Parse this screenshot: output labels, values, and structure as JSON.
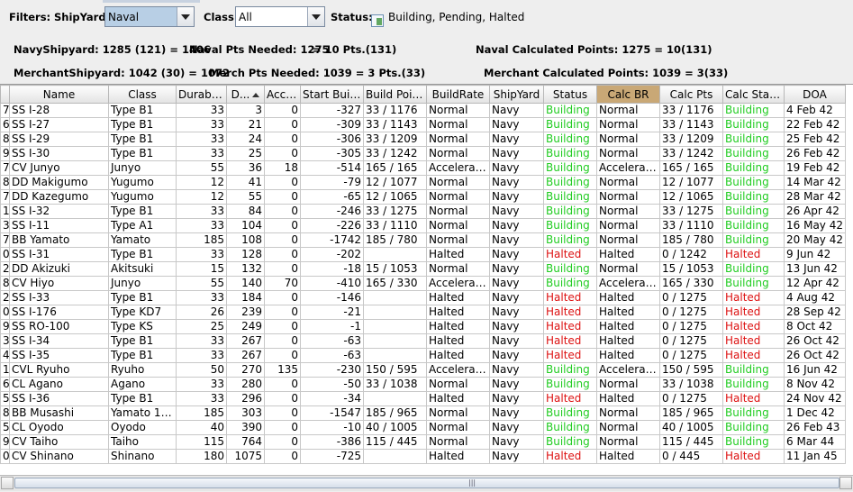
{
  "filters": {
    "label": "Filters:",
    "shipyard_label": "ShipYard:",
    "shipyard_value": "Naval",
    "class_label": "Class:",
    "class_value": "All",
    "status_label": "Status:",
    "status_value": "Building, Pending, Halted"
  },
  "summary": {
    "navy_shipyard": "NavyShipyard: 1285 (121) = 1406",
    "naval_pts_needed": "Naval Pts Needed: 1275",
    "naval_pts_result": "= 10 Pts.(131)",
    "naval_calc": "Naval Calculated Points:   1275 = 10(131)",
    "merchant_shipyard": "MerchantShipyard:  1042 (30) = 1072",
    "merch_pts_needed": "Merch Pts Needed: 1039 = 3 Pts.(33)",
    "merchant_calc": "Merchant Calculated Points:   1039 = 3(33)"
  },
  "table": {
    "columns": [
      "",
      "Name",
      "Class",
      "Durability",
      "D...",
      "Accel...",
      "Start Buildi...",
      "Build Point...",
      "BuildRate",
      "ShipYard",
      "Status",
      "Calc BR",
      "Calc Pts",
      "Calc Status",
      "DOA"
    ],
    "rows": [
      [
        "7",
        "SS I-28",
        "Type B1",
        "33",
        "3",
        "0",
        "-327",
        "33 / 1176",
        "Normal",
        "Navy",
        "Building",
        "Normal",
        "33 / 1176",
        "Building",
        "4 Feb 42"
      ],
      [
        "6",
        "SS I-27",
        "Type B1",
        "33",
        "21",
        "0",
        "-309",
        "33 / 1143",
        "Normal",
        "Navy",
        "Building",
        "Normal",
        "33 / 1143",
        "Building",
        "22 Feb 42"
      ],
      [
        "8",
        "SS I-29",
        "Type B1",
        "33",
        "24",
        "0",
        "-306",
        "33 / 1209",
        "Normal",
        "Navy",
        "Building",
        "Normal",
        "33 / 1209",
        "Building",
        "25 Feb 42"
      ],
      [
        "9",
        "SS I-30",
        "Type B1",
        "33",
        "25",
        "0",
        "-305",
        "33 / 1242",
        "Normal",
        "Navy",
        "Building",
        "Normal",
        "33 / 1242",
        "Building",
        "26 Feb 42"
      ],
      [
        "7",
        "CV Junyo",
        "Junyo",
        "55",
        "36",
        "18",
        "-514",
        "165 / 165",
        "Accelerated",
        "Navy",
        "Building",
        "Accelerated",
        "165 / 165",
        "Building",
        "19 Feb 42"
      ],
      [
        "8",
        "DD Makigumo",
        "Yugumo",
        "12",
        "41",
        "0",
        "-79",
        "12 / 1077",
        "Normal",
        "Navy",
        "Building",
        "Normal",
        "12 / 1077",
        "Building",
        "14 Mar 42"
      ],
      [
        "7",
        "DD Kazegumo",
        "Yugumo",
        "12",
        "55",
        "0",
        "-65",
        "12 / 1065",
        "Normal",
        "Navy",
        "Building",
        "Normal",
        "12 / 1065",
        "Building",
        "28 Mar 42"
      ],
      [
        "1",
        "SS I-32",
        "Type B1",
        "33",
        "84",
        "0",
        "-246",
        "33 / 1275",
        "Normal",
        "Navy",
        "Building",
        "Normal",
        "33 / 1275",
        "Building",
        "26 Apr 42"
      ],
      [
        "3",
        "SS I-11",
        "Type A1",
        "33",
        "104",
        "0",
        "-226",
        "33 / 1110",
        "Normal",
        "Navy",
        "Building",
        "Normal",
        "33 / 1110",
        "Building",
        "16 May 42"
      ],
      [
        "7",
        "BB Yamato",
        "Yamato",
        "185",
        "108",
        "0",
        "-1742",
        "185 / 780",
        "Normal",
        "Navy",
        "Building",
        "Normal",
        "185 / 780",
        "Building",
        "20 May 42"
      ],
      [
        "0",
        "SS I-31",
        "Type B1",
        "33",
        "128",
        "0",
        "-202",
        "",
        "Halted",
        "Navy",
        "Halted",
        "Halted",
        "0 / 1242",
        "Halted",
        "9 Jun 42"
      ],
      [
        "2",
        "DD Akizuki",
        "Akitsuki",
        "15",
        "132",
        "0",
        "-18",
        "15 / 1053",
        "Normal",
        "Navy",
        "Building",
        "Normal",
        "15 / 1053",
        "Building",
        "13 Jun 42"
      ],
      [
        "8",
        "CV Hiyo",
        "Junyo",
        "55",
        "140",
        "70",
        "-410",
        "165 / 330",
        "Accelerated",
        "Navy",
        "Building",
        "Accelerated",
        "165 / 330",
        "Building",
        "12 Apr 42"
      ],
      [
        "2",
        "SS I-33",
        "Type B1",
        "33",
        "184",
        "0",
        "-146",
        "",
        "Halted",
        "Navy",
        "Halted",
        "Halted",
        "0 / 1275",
        "Halted",
        "4 Aug 42"
      ],
      [
        "0",
        "SS I-176",
        "Type KD7",
        "26",
        "239",
        "0",
        "-21",
        "",
        "Halted",
        "Navy",
        "Halted",
        "Halted",
        "0 / 1275",
        "Halted",
        "28 Sep 42"
      ],
      [
        "9",
        "SS RO-100",
        "Type KS",
        "25",
        "249",
        "0",
        "-1",
        "",
        "Halted",
        "Navy",
        "Halted",
        "Halted",
        "0 / 1275",
        "Halted",
        "8 Oct 42"
      ],
      [
        "3",
        "SS I-34",
        "Type B1",
        "33",
        "267",
        "0",
        "-63",
        "",
        "Halted",
        "Navy",
        "Halted",
        "Halted",
        "0 / 1275",
        "Halted",
        "26 Oct 42"
      ],
      [
        "4",
        "SS I-35",
        "Type B1",
        "33",
        "267",
        "0",
        "-63",
        "",
        "Halted",
        "Navy",
        "Halted",
        "Halted",
        "0 / 1275",
        "Halted",
        "26 Oct 42"
      ],
      [
        "1",
        "CVL Ryuho",
        "Ryuho",
        "50",
        "270",
        "135",
        "-230",
        "150 / 595",
        "Accelerated",
        "Navy",
        "Building",
        "Accelerated",
        "150 / 595",
        "Building",
        "16 Jun 42"
      ],
      [
        "6",
        "CL Agano",
        "Agano",
        "33",
        "280",
        "0",
        "-50",
        "33 / 1038",
        "Normal",
        "Navy",
        "Building",
        "Normal",
        "33 / 1038",
        "Building",
        "8 Nov 42"
      ],
      [
        "5",
        "SS I-36",
        "Type B1",
        "33",
        "296",
        "0",
        "-34",
        "",
        "Halted",
        "Navy",
        "Halted",
        "Halted",
        "0 / 1275",
        "Halted",
        "24 Nov 42"
      ],
      [
        "8",
        "BB Musashi",
        "Yamato 12/...",
        "185",
        "303",
        "0",
        "-1547",
        "185 / 965",
        "Normal",
        "Navy",
        "Building",
        "Normal",
        "185 / 965",
        "Building",
        "1 Dec 42"
      ],
      [
        "5",
        "CL Oyodo",
        "Oyodo",
        "40",
        "390",
        "0",
        "-10",
        "40 / 1005",
        "Normal",
        "Navy",
        "Building",
        "Normal",
        "40 / 1005",
        "Building",
        "26 Feb 43"
      ],
      [
        "9",
        "CV Taiho",
        "Taiho",
        "115",
        "764",
        "0",
        "-386",
        "115 / 445",
        "Normal",
        "Navy",
        "Building",
        "Normal",
        "115 / 445",
        "Building",
        "6 Mar 44"
      ],
      [
        "0",
        "CV Shinano",
        "Shinano",
        "180",
        "1075",
        "0",
        "-725",
        "",
        "Halted",
        "Navy",
        "Halted",
        "Halted",
        "0 / 445",
        "Halted",
        "11 Jan 45"
      ]
    ]
  },
  "scrollbar": {
    "grip": "|||"
  }
}
